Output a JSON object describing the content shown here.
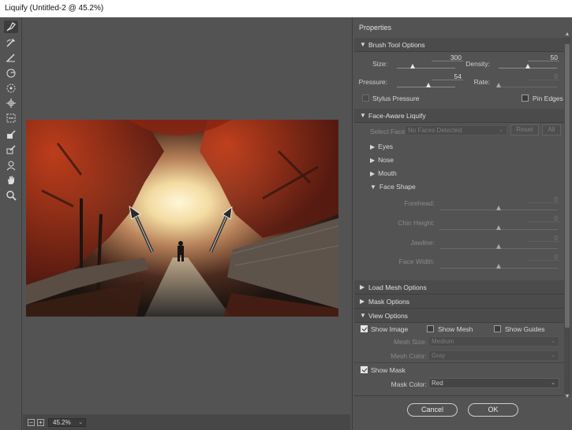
{
  "window": {
    "title": "Liquify (Untitled-2 @ 45.2%)"
  },
  "tools": [
    {
      "name": "forward-warp-tool-icon",
      "active": true
    },
    {
      "name": "reconstruct-tool-icon"
    },
    {
      "name": "smooth-tool-icon"
    },
    {
      "name": "twirl-clockwise-tool-icon"
    },
    {
      "name": "pucker-tool-icon"
    },
    {
      "name": "bloat-tool-icon"
    },
    {
      "name": "push-left-tool-icon"
    },
    {
      "name": "freeze-mask-tool-icon"
    },
    {
      "name": "thaw-mask-tool-icon"
    },
    {
      "name": "face-tool-icon"
    },
    {
      "name": "hand-tool-icon"
    },
    {
      "name": "zoom-tool-icon"
    }
  ],
  "canvas": {
    "zoom_minus": "−",
    "zoom_plus": "+",
    "zoom_level": "45.2%"
  },
  "properties": {
    "title": "Properties",
    "brush_tool_options": {
      "header": "Brush Tool Options",
      "size_label": "Size:",
      "size_value": "300",
      "density_label": "Density:",
      "density_value": "50",
      "pressure_label": "Pressure:",
      "pressure_value": "54",
      "rate_label": "Rate:",
      "rate_value": "0",
      "stylus_pressure_label": "Stylus Pressure",
      "pin_edges_label": "Pin Edges"
    },
    "face_aware": {
      "header": "Face-Aware Liquify",
      "select_face_label": "Select Face:",
      "select_face_value": "No Faces Detected",
      "reset_label": "Reset",
      "all_label": "All",
      "eyes_label": "Eyes",
      "nose_label": "Nose",
      "mouth_label": "Mouth",
      "face_shape_label": "Face Shape",
      "forehead_label": "Forehead:",
      "forehead_value": "0",
      "chin_height_label": "Chin Height:",
      "chin_height_value": "0",
      "jawline_label": "Jawline:",
      "jawline_value": "0",
      "face_width_label": "Face Width:",
      "face_width_value": "0"
    },
    "load_mesh_options": "Load Mesh Options",
    "mask_options": "Mask Options",
    "view_options": {
      "header": "View Options",
      "show_image_label": "Show Image",
      "show_mesh_label": "Show Mesh",
      "show_guides_label": "Show Guides",
      "mesh_size_label": "Mesh Size:",
      "mesh_size_value": "Medium",
      "mesh_color_label": "Mesh Color:",
      "mesh_color_value": "Gray",
      "show_mask_label": "Show Mask",
      "mask_color_label": "Mask Color:",
      "mask_color_value": "Red"
    }
  },
  "footer": {
    "cancel_label": "Cancel",
    "ok_label": "OK"
  },
  "colors": {
    "panel_bg": "#535353",
    "section_bg": "#4b4b4b",
    "title_bg": "#ffffff"
  }
}
